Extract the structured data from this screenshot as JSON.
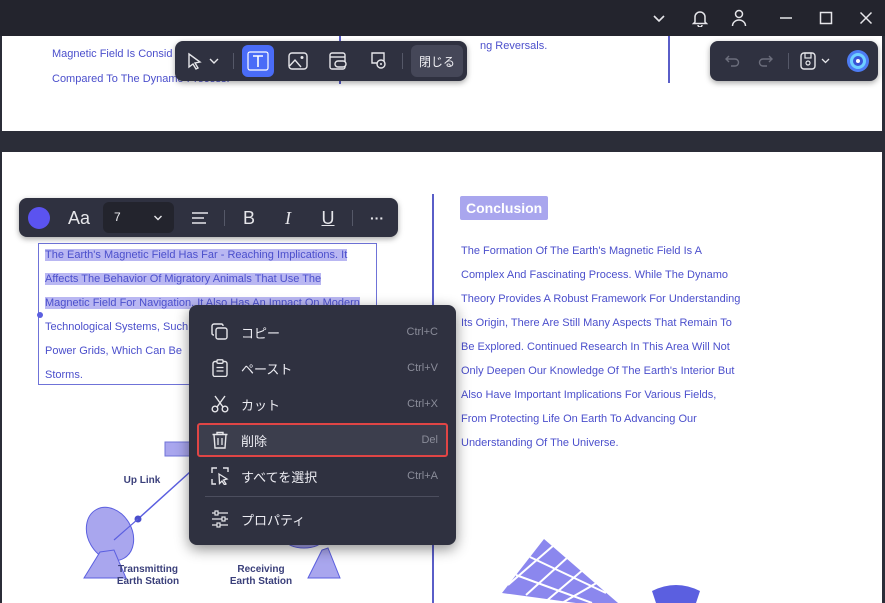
{
  "window": {
    "controls": [
      "chevron-down-icon",
      "bell-icon",
      "user-icon",
      "minimize-icon",
      "maximize-icon",
      "close-icon"
    ]
  },
  "page_top": {
    "left_lines": [
      "Magnetic Field Is Consid",
      "Compared To The Dynamo Process."
    ],
    "middle_fragment": "ng Reversals."
  },
  "edit_toolbar": {
    "tools": [
      "select-tool",
      "text-tool",
      "image-tool",
      "link-tool",
      "stamp-tool"
    ],
    "close_label": "閉じる"
  },
  "right_toolbar": {
    "items": [
      "undo-icon",
      "redo-icon",
      "save-icon",
      "ai-assistant-icon"
    ]
  },
  "text_format_bar": {
    "color": "#5b53f0",
    "font_icon_label": "Aa",
    "font_size": "7",
    "bold": "B",
    "italic": "I",
    "underline": "U",
    "more": "···"
  },
  "left_block": {
    "lines": [
      "The Earth's Magnetic Field Has Far - Reaching Implications. It",
      "Affects The Behavior Of Migratory Animals That Use The",
      "Magnetic Field For Navigation. It Also Has An Impact On Modern",
      "Technological Systems, Such",
      "Power Grids, Which Can Be",
      "Storms."
    ]
  },
  "conclusion": {
    "heading": "Conclusion",
    "lines": [
      "The Formation Of The Earth's Magnetic Field Is A",
      "Complex And Fascinating Process. While The Dynamo",
      "Theory Provides A Robust Framework For Understanding",
      "Its Origin, There Are Still Many Aspects That Remain To",
      "Be Explored. Continued Research In This Area Will Not",
      "Only Deepen Our Knowledge Of The Earth's Interior But",
      "Also Have Important Implications For Various Fields,",
      "From Protecting Life On Earth To Advancing Our",
      "Understanding Of The Universe."
    ]
  },
  "diagram": {
    "up_link": "Up Link",
    "transmitting": "Transmitting\nEarth Station",
    "receiving": "Receiving\nEarth Station"
  },
  "context_menu": {
    "items": [
      {
        "label": "コピー",
        "shortcut": "Ctrl+C",
        "icon": "copy-icon"
      },
      {
        "label": "ペースト",
        "shortcut": "Ctrl+V",
        "icon": "paste-icon"
      },
      {
        "label": "カット",
        "shortcut": "Ctrl+X",
        "icon": "scissors-icon"
      },
      {
        "label": "削除",
        "shortcut": "Del",
        "icon": "trash-icon"
      },
      {
        "label": "すべてを選択",
        "shortcut": "Ctrl+A",
        "icon": "select-all-icon"
      },
      {
        "label": "プロパティ",
        "shortcut": "",
        "icon": "sliders-icon"
      }
    ],
    "active_item": "削除"
  }
}
